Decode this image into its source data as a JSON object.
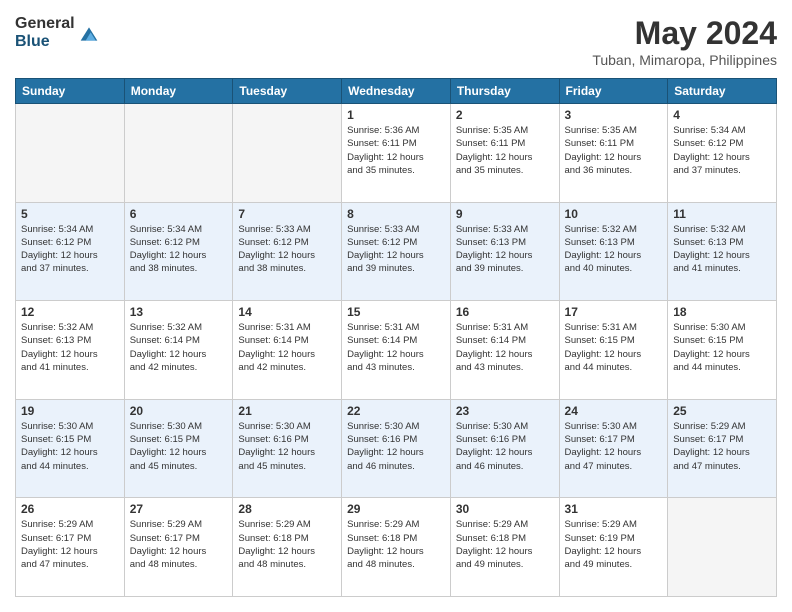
{
  "logo": {
    "general": "General",
    "blue": "Blue"
  },
  "header": {
    "month": "May 2024",
    "location": "Tuban, Mimaropa, Philippines"
  },
  "weekdays": [
    "Sunday",
    "Monday",
    "Tuesday",
    "Wednesday",
    "Thursday",
    "Friday",
    "Saturday"
  ],
  "weeks": [
    [
      {
        "day": "",
        "info": ""
      },
      {
        "day": "",
        "info": ""
      },
      {
        "day": "",
        "info": ""
      },
      {
        "day": "1",
        "info": "Sunrise: 5:36 AM\nSunset: 6:11 PM\nDaylight: 12 hours\nand 35 minutes."
      },
      {
        "day": "2",
        "info": "Sunrise: 5:35 AM\nSunset: 6:11 PM\nDaylight: 12 hours\nand 35 minutes."
      },
      {
        "day": "3",
        "info": "Sunrise: 5:35 AM\nSunset: 6:11 PM\nDaylight: 12 hours\nand 36 minutes."
      },
      {
        "day": "4",
        "info": "Sunrise: 5:34 AM\nSunset: 6:12 PM\nDaylight: 12 hours\nand 37 minutes."
      }
    ],
    [
      {
        "day": "5",
        "info": "Sunrise: 5:34 AM\nSunset: 6:12 PM\nDaylight: 12 hours\nand 37 minutes."
      },
      {
        "day": "6",
        "info": "Sunrise: 5:34 AM\nSunset: 6:12 PM\nDaylight: 12 hours\nand 38 minutes."
      },
      {
        "day": "7",
        "info": "Sunrise: 5:33 AM\nSunset: 6:12 PM\nDaylight: 12 hours\nand 38 minutes."
      },
      {
        "day": "8",
        "info": "Sunrise: 5:33 AM\nSunset: 6:12 PM\nDaylight: 12 hours\nand 39 minutes."
      },
      {
        "day": "9",
        "info": "Sunrise: 5:33 AM\nSunset: 6:13 PM\nDaylight: 12 hours\nand 39 minutes."
      },
      {
        "day": "10",
        "info": "Sunrise: 5:32 AM\nSunset: 6:13 PM\nDaylight: 12 hours\nand 40 minutes."
      },
      {
        "day": "11",
        "info": "Sunrise: 5:32 AM\nSunset: 6:13 PM\nDaylight: 12 hours\nand 41 minutes."
      }
    ],
    [
      {
        "day": "12",
        "info": "Sunrise: 5:32 AM\nSunset: 6:13 PM\nDaylight: 12 hours\nand 41 minutes."
      },
      {
        "day": "13",
        "info": "Sunrise: 5:32 AM\nSunset: 6:14 PM\nDaylight: 12 hours\nand 42 minutes."
      },
      {
        "day": "14",
        "info": "Sunrise: 5:31 AM\nSunset: 6:14 PM\nDaylight: 12 hours\nand 42 minutes."
      },
      {
        "day": "15",
        "info": "Sunrise: 5:31 AM\nSunset: 6:14 PM\nDaylight: 12 hours\nand 43 minutes."
      },
      {
        "day": "16",
        "info": "Sunrise: 5:31 AM\nSunset: 6:14 PM\nDaylight: 12 hours\nand 43 minutes."
      },
      {
        "day": "17",
        "info": "Sunrise: 5:31 AM\nSunset: 6:15 PM\nDaylight: 12 hours\nand 44 minutes."
      },
      {
        "day": "18",
        "info": "Sunrise: 5:30 AM\nSunset: 6:15 PM\nDaylight: 12 hours\nand 44 minutes."
      }
    ],
    [
      {
        "day": "19",
        "info": "Sunrise: 5:30 AM\nSunset: 6:15 PM\nDaylight: 12 hours\nand 44 minutes."
      },
      {
        "day": "20",
        "info": "Sunrise: 5:30 AM\nSunset: 6:15 PM\nDaylight: 12 hours\nand 45 minutes."
      },
      {
        "day": "21",
        "info": "Sunrise: 5:30 AM\nSunset: 6:16 PM\nDaylight: 12 hours\nand 45 minutes."
      },
      {
        "day": "22",
        "info": "Sunrise: 5:30 AM\nSunset: 6:16 PM\nDaylight: 12 hours\nand 46 minutes."
      },
      {
        "day": "23",
        "info": "Sunrise: 5:30 AM\nSunset: 6:16 PM\nDaylight: 12 hours\nand 46 minutes."
      },
      {
        "day": "24",
        "info": "Sunrise: 5:30 AM\nSunset: 6:17 PM\nDaylight: 12 hours\nand 47 minutes."
      },
      {
        "day": "25",
        "info": "Sunrise: 5:29 AM\nSunset: 6:17 PM\nDaylight: 12 hours\nand 47 minutes."
      }
    ],
    [
      {
        "day": "26",
        "info": "Sunrise: 5:29 AM\nSunset: 6:17 PM\nDaylight: 12 hours\nand 47 minutes."
      },
      {
        "day": "27",
        "info": "Sunrise: 5:29 AM\nSunset: 6:17 PM\nDaylight: 12 hours\nand 48 minutes."
      },
      {
        "day": "28",
        "info": "Sunrise: 5:29 AM\nSunset: 6:18 PM\nDaylight: 12 hours\nand 48 minutes."
      },
      {
        "day": "29",
        "info": "Sunrise: 5:29 AM\nSunset: 6:18 PM\nDaylight: 12 hours\nand 48 minutes."
      },
      {
        "day": "30",
        "info": "Sunrise: 5:29 AM\nSunset: 6:18 PM\nDaylight: 12 hours\nand 49 minutes."
      },
      {
        "day": "31",
        "info": "Sunrise: 5:29 AM\nSunset: 6:19 PM\nDaylight: 12 hours\nand 49 minutes."
      },
      {
        "day": "",
        "info": ""
      }
    ]
  ]
}
